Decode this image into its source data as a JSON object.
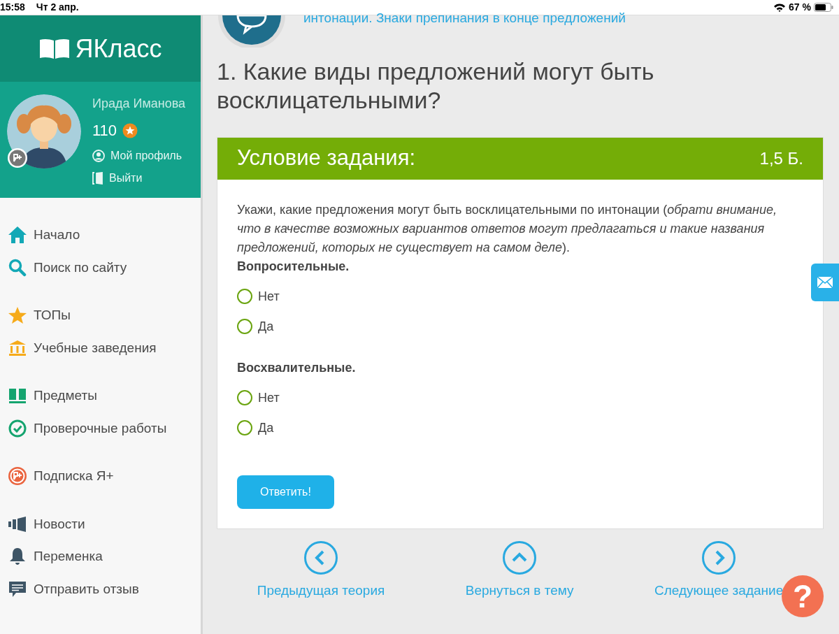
{
  "status_bar": {
    "time": "15:58",
    "date": "Чт 2 апр.",
    "battery": "67 %"
  },
  "sidebar": {
    "logo": "ЯКласс",
    "user": {
      "name": "Ирада Иманова",
      "points": "110",
      "links": [
        {
          "label": "Мой профиль",
          "kind": "profile"
        },
        {
          "label": "Выйти",
          "kind": "exit"
        }
      ]
    },
    "menu": [
      {
        "items": [
          {
            "label": "Начало",
            "kind": "home"
          },
          {
            "label": "Поиск по сайту",
            "kind": "search"
          }
        ]
      },
      {
        "items": [
          {
            "label": "ТОПы",
            "kind": "star"
          },
          {
            "label": "Учебные заведения",
            "kind": "school"
          }
        ]
      },
      {
        "items": [
          {
            "label": "Предметы",
            "kind": "book"
          },
          {
            "label": "Проверочные работы",
            "kind": "check"
          }
        ]
      },
      {
        "items": [
          {
            "label": "Подписка Я+",
            "kind": "plus"
          }
        ]
      },
      {
        "items": [
          {
            "label": "Новости",
            "kind": "news"
          },
          {
            "label": "Переменка",
            "kind": "bell"
          },
          {
            "label": "Отправить отзыв",
            "kind": "feedback"
          }
        ]
      }
    ]
  },
  "breadcrumb": "интонации. Знаки препинания в конце предложений",
  "question_title": "1. Какие виды предложений могут быть восклицательными?",
  "task": {
    "header": "Условие задания:",
    "points": "1,5 Б.",
    "text": "Укажи, какие предложения могут быть восклицательными по интонации (*обрати внимание, что в качестве возможных вариантов ответов могут предлагаться и такие названия предложений, которых не существует на самом деле*).",
    "groups": [
      {
        "label": "Вопросительные.",
        "options": [
          {
            "label": "Нет",
            "selected": false
          },
          {
            "label": "Да",
            "selected": false
          }
        ]
      },
      {
        "label": "Восхвалительные.",
        "options": [
          {
            "label": "Нет",
            "selected": false
          },
          {
            "label": "Да",
            "selected": false
          }
        ]
      }
    ],
    "submit": "Ответить!"
  },
  "nav": [
    {
      "label": "Предыдущая теория",
      "kind": "prev"
    },
    {
      "label": "Вернуться в тему",
      "kind": "up"
    },
    {
      "label": "Следующее задание",
      "kind": "next"
    }
  ],
  "help": "?"
}
